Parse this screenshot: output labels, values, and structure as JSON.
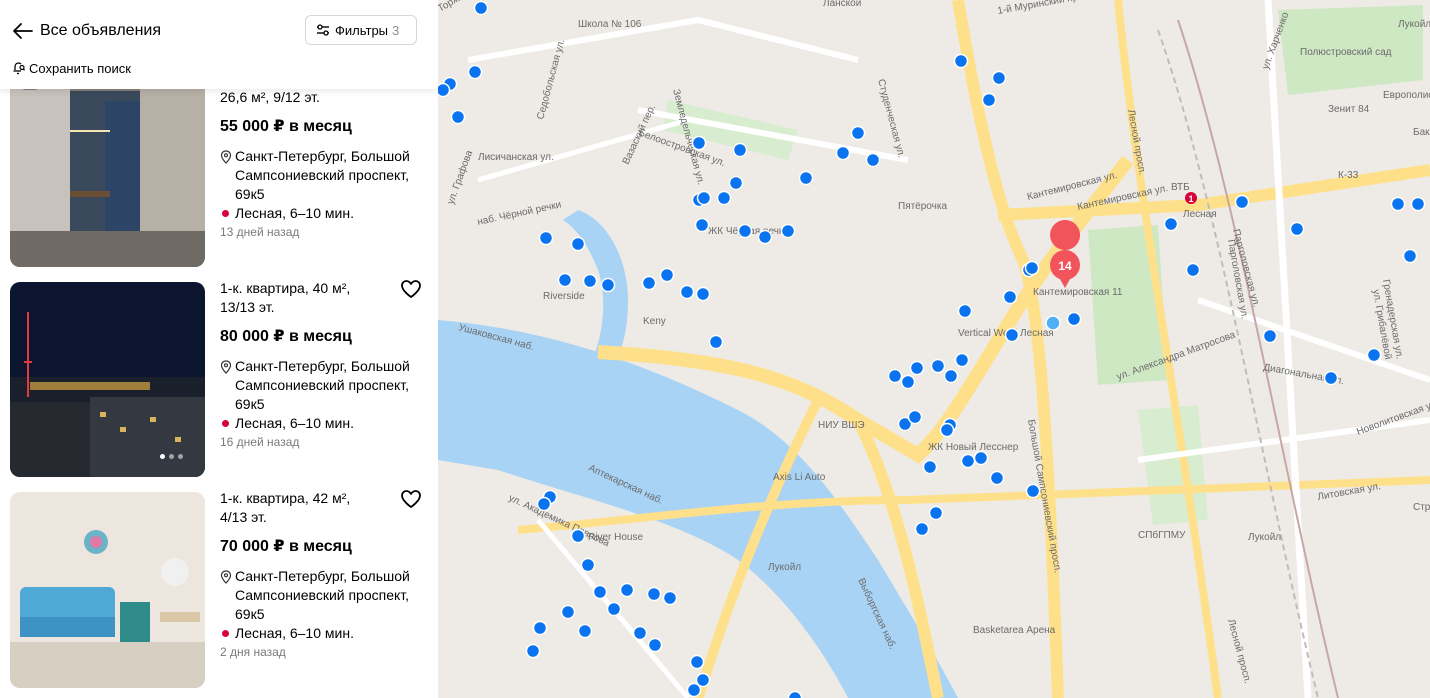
{
  "header": {
    "back_label": "Все объявления",
    "filters_label": "Фильтры",
    "filters_count": "3",
    "save_search_label": "Сохранить поиск"
  },
  "listings": [
    {
      "title": "26,6 м², 9/12 эт.",
      "price": "55 000 ₽ в месяц",
      "address": "Санкт-Петербург, Большой Сампсониевский проспект, 69к5",
      "metro": "Лесная, 6–10 мин.",
      "date": "13 дней назад"
    },
    {
      "title": "1-к. квартира, 40 м², 13/13 эт.",
      "price": "80 000 ₽ в месяц",
      "address": "Санкт-Петербург, Большой Сампсониевский проспект, 69к5",
      "metro": "Лесная, 6–10 мин.",
      "date": "16 дней назад"
    },
    {
      "title": "1-к. квартира, 42 м², 4/13 эт.",
      "price": "70 000 ₽ в месяц",
      "address": "Санкт-Петербург, Большой Сампсониевский проспект, 69к5",
      "metro": "Лесная, 6–10 мин.",
      "date": "2 дня назад"
    }
  ],
  "map": {
    "cluster_count": "14",
    "metro_line_number": "1",
    "colors": {
      "marker": "#0a74f0",
      "marker_selected": "#4fb0f5",
      "cluster": "#f2545b",
      "water": "#a9d3f5",
      "park": "#cfe8c4",
      "road": "#ffe08a"
    },
    "street_labels": [
      "Торж",
      "Школа № 106",
      "Ланской",
      "1-й Муринский пр.",
      "Лесной просп.",
      "ул. Харченко",
      "Полюстровский сад",
      "Зенит 84",
      "Европолис",
      "Бакла",
      "Лукойл",
      "Седобольская ул.",
      "Земледельческая ул.",
      "Студенческая ул.",
      "Белоостровская ул.",
      "Лисичанская ул.",
      "ул. Графова",
      "Вазаский пер.",
      "Пятёрочка",
      "ВТБ",
      "Лесная",
      "Кантемировская ул.",
      "Парголовская ул.",
      "К-33",
      "Гренадерская ул.",
      "наб. Чёрной речки",
      "ЖК Чёрная речка",
      "Riverside",
      "Keny",
      "Кантемировская 11",
      "Vertical We&i Лесная",
      "Ушаковская наб.",
      "Выборгская наб.",
      "НИУ ВШЭ",
      "Axis Li Auto",
      "ЖК Новый Лесснер",
      "ул. Александра Матросова",
      "Диагональная ул.",
      "Новолитовская ул.",
      "Литовская ул.",
      "Большой Сампсониевский просп.",
      "Лукойл",
      "Аптекарская наб.",
      "River House",
      "ул. Академика Павлова",
      "СПбГПМУ",
      "Basketarea Арена",
      "Лесной просп.",
      "Кантемировская ул.",
      "Строй",
      "ул. Грибалёвой",
      "Парголовская ул.",
      "Лукойл"
    ]
  },
  "icons": {
    "back": "arrow-left-icon",
    "filters": "sliders-icon",
    "save_search": "bell-search-icon",
    "pin": "location-pin-icon",
    "heart": "heart-icon"
  }
}
